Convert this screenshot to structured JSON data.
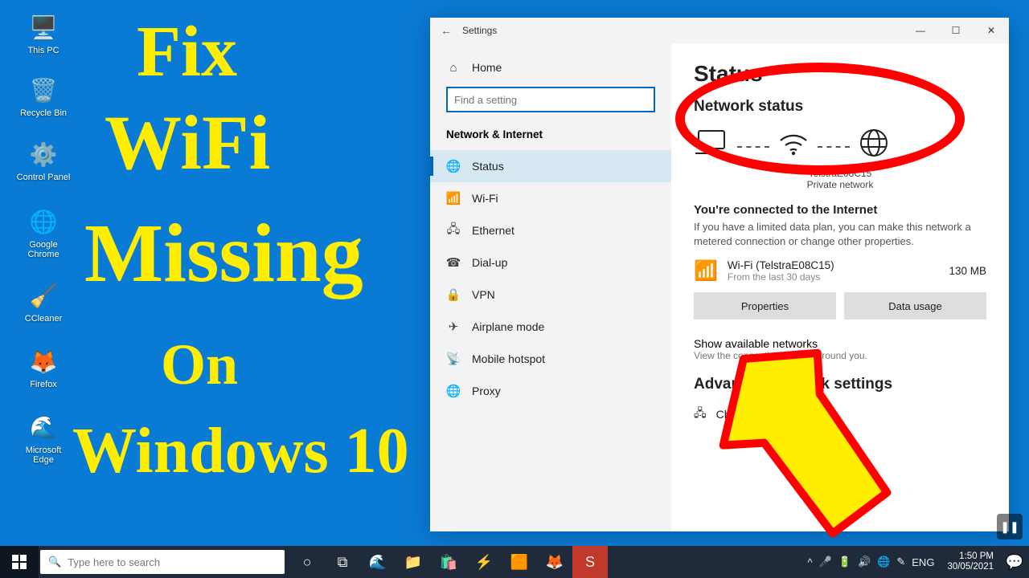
{
  "desktop": {
    "icons": [
      {
        "label": "This PC",
        "glyph": "🖥️"
      },
      {
        "label": "Recycle Bin",
        "glyph": "🗑️"
      },
      {
        "label": "Control Panel",
        "glyph": "⚙️"
      },
      {
        "label": "Google Chrome",
        "glyph": "🌐"
      },
      {
        "label": "CCleaner",
        "glyph": "🧹"
      },
      {
        "label": "Firefox",
        "glyph": "🦊"
      },
      {
        "label": "Microsoft Edge",
        "glyph": "🌊"
      }
    ]
  },
  "overlay": {
    "line1": "Fix",
    "line2": "WiFi",
    "line3": "Missing",
    "line4": "On",
    "line5": "Windows 10"
  },
  "settings": {
    "title": "Settings",
    "home": "Home",
    "search_placeholder": "Find a setting",
    "section": "Network & Internet",
    "nav": [
      {
        "label": "Status",
        "glyph": "🌐"
      },
      {
        "label": "Wi-Fi",
        "glyph": "📶"
      },
      {
        "label": "Ethernet",
        "glyph": "🖧"
      },
      {
        "label": "Dial-up",
        "glyph": "☎"
      },
      {
        "label": "VPN",
        "glyph": "🔒"
      },
      {
        "label": "Airplane mode",
        "glyph": "✈"
      },
      {
        "label": "Mobile hotspot",
        "glyph": "📡"
      },
      {
        "label": "Proxy",
        "glyph": "🌐"
      }
    ],
    "content": {
      "h1": "Status",
      "h2": "Network status",
      "network_name": "TelstraE08C15",
      "network_type": "Private network",
      "connected_title": "You're connected to the Internet",
      "connected_desc": "If you have a limited data plan, you can make this network a metered connection or change other properties.",
      "wifi_label": "Wi-Fi (TelstraE08C15)",
      "wifi_sub": "From the last 30 days",
      "usage": "130 MB",
      "properties_btn": "Properties",
      "data_usage_btn": "Data usage",
      "show_available": "Show available networks",
      "show_available_sub": "View the connection options around you.",
      "advanced_h": "Advanced network settings",
      "change_adapter": "Change adapter options"
    }
  },
  "taskbar": {
    "search_placeholder": "Type here to search",
    "lang": "ENG",
    "time": "1:50 PM",
    "date": "30/05/2021"
  }
}
